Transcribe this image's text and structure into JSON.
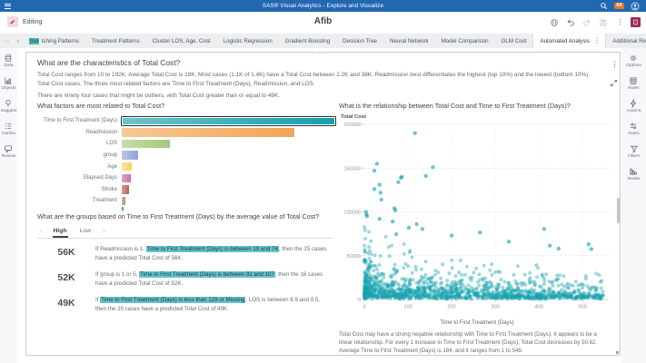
{
  "colors": {
    "topbar_blue": "#2267b2",
    "accent_teal": "#17a2ad",
    "highlight_teal": "#66c3cb",
    "badge_orange": "#e8762c",
    "editing_magenta": "#9c2f62",
    "selected_bar_outline": "#2b2f33"
  },
  "app": {
    "top_bar": {
      "title": "SAS® Visual Analytics - Explore and Visualize",
      "badge": "69"
    },
    "toolbar": {
      "mode_label": "Editing",
      "report_title": "Afib"
    },
    "tabs": {
      "items": [
        "Switching Patterns",
        "Treatment Patterns",
        "Cluster LOS, Age, Cost",
        "Logistic Regression",
        "Gradient Boosting",
        "Decision Tree",
        "Neural Network",
        "Model Comparison",
        "GLM Cost",
        "Automated Analysis",
        "Additional Reports"
      ],
      "active": "Automated Analysis",
      "highlight": {
        "tab": "Switching Patterns",
        "prefix_chars": 3
      }
    }
  },
  "left_rail": {
    "items": [
      {
        "label": "Data",
        "icon": "database-icon"
      },
      {
        "label": "Objects",
        "icon": "objects-chart-icon"
      },
      {
        "label": "Suggest",
        "icon": "suggest-bulb-icon"
      },
      {
        "label": "Outline",
        "icon": "outline-list-icon"
      },
      {
        "label": "Review",
        "icon": "review-comment-icon"
      }
    ]
  },
  "right_rail": {
    "items": [
      {
        "label": "Options",
        "icon": "options-gear-icon"
      },
      {
        "label": "Roles",
        "icon": "roles-icon"
      },
      {
        "label": "Actions",
        "icon": "actions-icon"
      },
      {
        "label": "Rules",
        "icon": "rules-icon"
      },
      {
        "label": "Filters",
        "icon": "filter-funnel-icon"
      },
      {
        "label": "Ranks",
        "icon": "ranks-icon"
      }
    ]
  },
  "panel": {
    "summary": {
      "heading": "What are the characteristics of Total Cost?",
      "p1": "Total Cost ranges from 10 to 192K. Average Total Cost is 18K. Most cases (1.1K of 1.4K) have a Total Cost between 2.2K and 38K. Readmission best differentiates the highest (top 10%) and the lowest (bottom 10%) Total Cost cases. The three most related factors are Time to First Treatment (Days), Readmission, and LOS.",
      "p2": "There are ninety four cases that might be outliers, with Total Cost greater than or equal to 49K."
    },
    "factors": {
      "heading": "What factors are most related to Total Cost?"
    },
    "groups": {
      "heading": "What are the groups based on Time to First Treatment (Days) by the average value of Total Cost?",
      "tabs": {
        "high": "High",
        "low": "Low"
      },
      "rows": [
        {
          "value": "56K",
          "segments": [
            {
              "text": "If Readmission is 1, "
            },
            {
              "text": "Time to First Treatment (Days) is between 19 and 74",
              "highlight": true
            },
            {
              "text": ", then the 25 cases have a predicted Total Cost of 56K."
            }
          ]
        },
        {
          "value": "52K",
          "segments": [
            {
              "text": "If group is 1 or 5, "
            },
            {
              "text": "Time to First Treatment (Days) is between 92 and 107",
              "highlight": true
            },
            {
              "text": ", then the 16 cases have a predicted Total Cost of 52K."
            }
          ]
        },
        {
          "value": "49K",
          "segments": [
            {
              "text": "If "
            },
            {
              "text": "Time to First Treatment (Days) is less than 129 or Missing",
              "highlight": true
            },
            {
              "text": ", LOS is between 8.9 and 9.5, then the 20 cases have a predicted Total Cost of 49K."
            }
          ]
        }
      ]
    },
    "scatter": {
      "heading": "What is the relationship between Total Cost and Time to First Treatment (Days)?",
      "caption": "Total Cost may have a strong negative relationship with Time to First Treatment (Days). It appears to be a linear relationship. For every 1 increase in Time to First Treatment (Days), Total Cost decreases by 50.62. Average Time to First Treatment (Days) is 184, and it ranges from 1 to 548."
    }
  },
  "chart_data": [
    {
      "type": "bar",
      "orientation": "horizontal",
      "title": "What factors are most related to Total Cost?",
      "categories": [
        "Time to First Treatment (Days)",
        "Readmission",
        "LOS",
        "group",
        "Age",
        "Elapsed Days",
        "Stroke",
        "Treatment"
      ],
      "values": [
        1.0,
        0.81,
        0.225,
        0.075,
        0.046,
        0.044,
        0.034,
        0.017
      ],
      "value_meaning": "relative importance (no axis labels shown)",
      "colors": [
        "#14a0aa",
        "#f2a556",
        "#a4c878",
        "#8fa3d9",
        "#f8d25c",
        "#c96fa6",
        "#bd5f55",
        "#ab9566"
      ],
      "selected": "Time to First Treatment (Days)",
      "grid": false,
      "legend": "none"
    },
    {
      "type": "scatter",
      "title": "What is the relationship between Total Cost and Time to First Treatment (Days)?",
      "xlabel": "Time to First Treatment (Days)",
      "ylabel": "Total Cost",
      "xlim": [
        0,
        560
      ],
      "ylim": [
        0,
        200000
      ],
      "xticks": [
        0,
        100,
        200,
        300,
        400,
        500
      ],
      "yticks": [
        0,
        50000,
        100000,
        150000,
        200000
      ],
      "grid": true,
      "legend": "none",
      "trend": "negative linear, slope -50.62, x range 1-548, mean x 184",
      "point_color": "#17a2ad",
      "n_points_approx": 1400,
      "outlier_points": [
        [
          116,
          190000
        ],
        [
          29,
          155000
        ],
        [
          157,
          151000
        ],
        [
          23,
          147000
        ],
        [
          141,
          141000
        ],
        [
          86,
          140000
        ],
        [
          84,
          139000
        ],
        [
          78,
          134000
        ],
        [
          35,
          131000
        ],
        [
          23,
          126000
        ],
        [
          37,
          122000
        ],
        [
          39,
          114000
        ],
        [
          69,
          104000
        ],
        [
          71,
          102000
        ],
        [
          4,
          100000
        ],
        [
          5,
          97000
        ],
        [
          6,
          95000
        ],
        [
          35,
          92000
        ],
        [
          65,
          89000
        ],
        [
          120,
          86000
        ],
        [
          102,
          82000
        ],
        [
          133,
          80500
        ],
        [
          412,
          80500
        ],
        [
          265,
          76500
        ],
        [
          73,
          74500
        ],
        [
          200,
          73000
        ],
        [
          331,
          66000
        ],
        [
          514,
          63000
        ],
        [
          425,
          61500
        ],
        [
          445,
          58000
        ],
        [
          520,
          57500
        ]
      ],
      "cloud": {
        "seed": 7,
        "count": 1280,
        "x_max": 548,
        "y_model": "lognormal decaying with x"
      }
    }
  ]
}
